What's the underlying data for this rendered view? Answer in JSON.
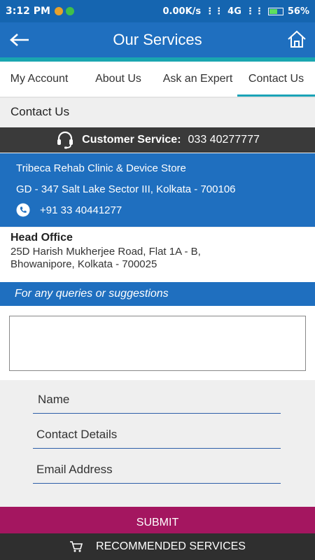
{
  "status_bar": {
    "time": "3:12 PM",
    "net_speed": "0.00K/s",
    "network": "4G",
    "battery": "56%",
    "battery_level": 0.56
  },
  "appbar": {
    "title": "Our Services",
    "back_icon": "arrow-left-icon",
    "home_icon": "home-icon"
  },
  "tabs": [
    {
      "label": "My Account",
      "active": false
    },
    {
      "label": "About Us",
      "active": false
    },
    {
      "label": "Ask an Expert",
      "active": false
    },
    {
      "label": "Contact Us",
      "active": true
    }
  ],
  "section_title": "Contact Us",
  "customer_service": {
    "label": "Customer Service:",
    "number": "033 40277777",
    "icon": "headset-icon"
  },
  "clinic": {
    "name": "Tribeca Rehab Clinic & Device Store",
    "address": "GD - 347 Salt Lake Sector III, Kolkata - 700106",
    "phone": "+91 33 40441277",
    "phone_icon": "phone-icon"
  },
  "head_office": {
    "heading": "Head Office",
    "line1": "25D Harish Mukherjee Road, Flat 1A - B,",
    "line2": "Bhowanipore, Kolkata - 700025"
  },
  "query_bar": "For any queries or suggestions",
  "query_text": "",
  "form": {
    "name_placeholder": "Name",
    "contact_placeholder": "Contact Details",
    "email_placeholder": "Email Address"
  },
  "submit_label": "SUBMIT",
  "recommend_label": "RECOMMENDED SERVICES",
  "colors": {
    "primary": "#1f6fbf",
    "accent": "#19a6b0",
    "submit": "#a41660",
    "dark": "#2f2f2f"
  }
}
